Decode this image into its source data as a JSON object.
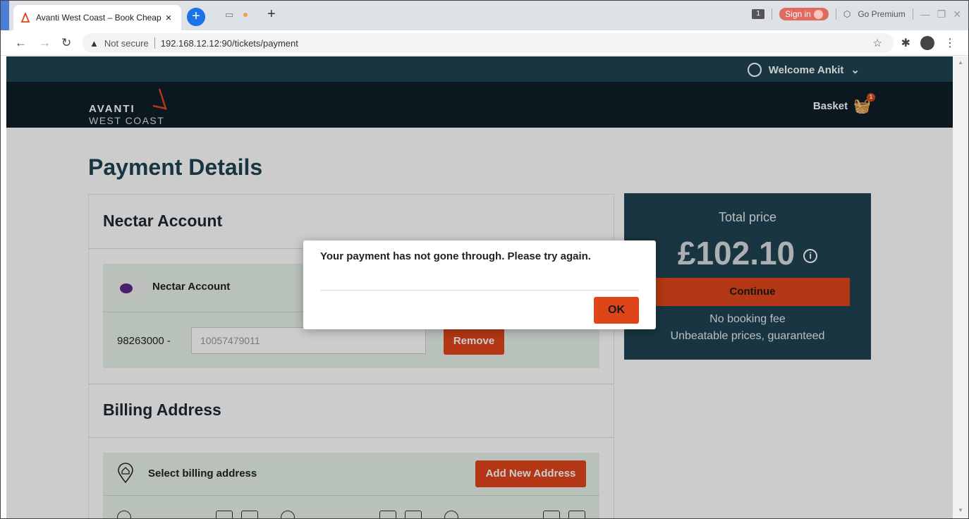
{
  "browser": {
    "tab_title": "Avanti West Coast – Book Cheap",
    "tab_close": "×",
    "new_tab": "+",
    "extension_badge": "1",
    "sign_in": "Sign in",
    "go_premium": "Go Premium",
    "not_secure": "Not secure",
    "url": "192.168.12.12:90/tickets/payment"
  },
  "topnav": {
    "welcome": "Welcome Ankit"
  },
  "header": {
    "logo_line1": "AVANTI",
    "logo_line2": "WEST COAST",
    "basket_label": "Basket",
    "basket_count": "1"
  },
  "page": {
    "title": "Payment Details"
  },
  "nectar": {
    "section_title": "Nectar Account",
    "panel_label": "Nectar Account",
    "prefix": "98263000 -",
    "number_value": "10057479011",
    "remove_button": "Remove"
  },
  "billing": {
    "section_title": "Billing Address",
    "select_label": "Select billing address",
    "add_button": "Add New Address"
  },
  "summary": {
    "total_label": "Total price",
    "total_value": "£102.10",
    "info_icon": "i",
    "continue_button": "Continue",
    "note1": "No booking fee",
    "note2": "Unbeatable prices, guaranteed"
  },
  "dialog": {
    "message": "Your payment has not gone through. Please try again.",
    "ok_button": "OK"
  },
  "colors": {
    "accent": "#e0451a",
    "navy": "#1e4352",
    "header_dark": "#0f1f29",
    "panel_green": "#e6f3ea"
  }
}
